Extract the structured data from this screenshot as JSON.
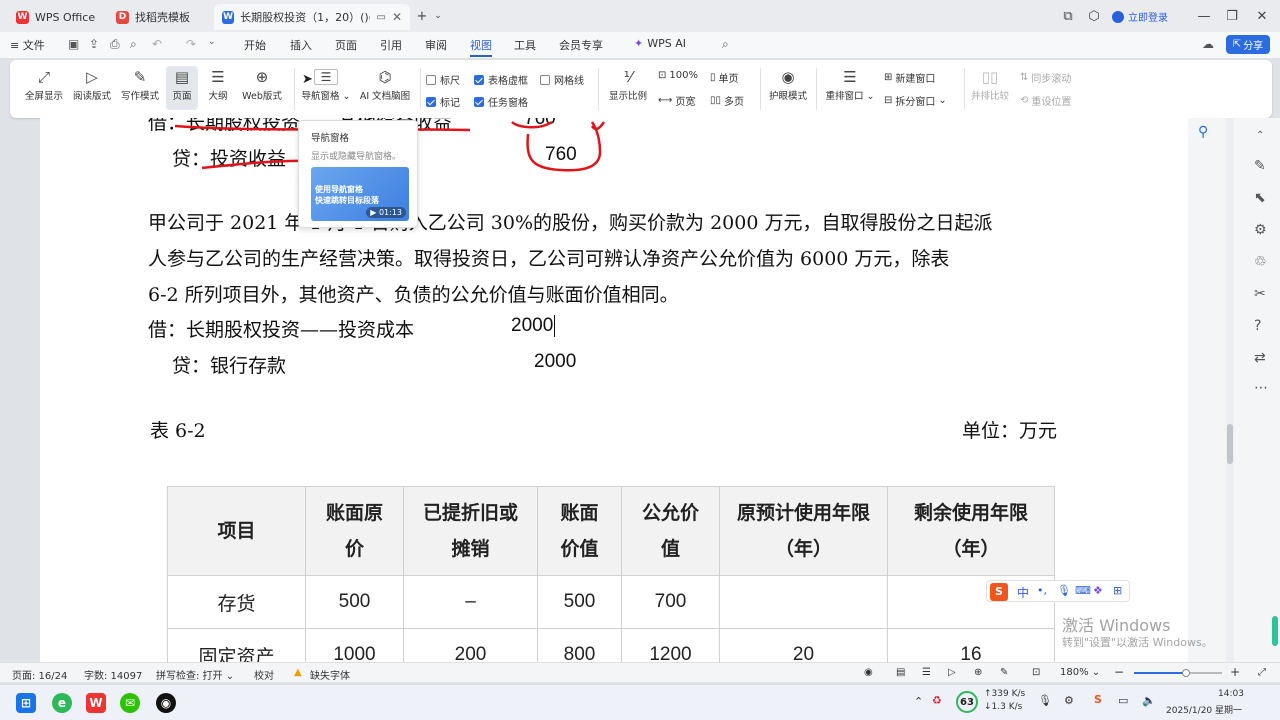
{
  "tabs": [
    {
      "label": "WPS Office",
      "icon": "wps-logo-icon",
      "color": "#e33"
    },
    {
      "label": "找稻壳模板",
      "icon": "docer-template-icon",
      "color": "#e5483c"
    },
    {
      "label": "长期股权投资（1，20）()(1).d",
      "icon": "word-doc-icon",
      "color": "#2b6de0"
    }
  ],
  "title_bar": {
    "login_label": "立即登录"
  },
  "menu": {
    "file_label": "文件",
    "items": [
      "开始",
      "插入",
      "页面",
      "引用",
      "审阅",
      "视图",
      "工具",
      "会员专享"
    ],
    "active": "视图",
    "wps_ai_label": "WPS AI",
    "share_label": "分享"
  },
  "ribbon": {
    "buttons": [
      "全屏显示",
      "阅读版式",
      "写作模式",
      "页面",
      "大纲",
      "Web版式",
      "导航窗格",
      "AI 文档脑图"
    ],
    "selected": "页面",
    "checks": [
      {
        "label": "标尺",
        "checked": false
      },
      {
        "label": "表格虚框",
        "checked": true
      },
      {
        "label": "网格线",
        "checked": false
      },
      {
        "label": "标记",
        "checked": true
      },
      {
        "label": "任务窗格",
        "checked": true
      }
    ],
    "zoom_buttons": [
      "显示比例",
      "100%",
      "单页",
      "页宽",
      "多页"
    ],
    "eye_label": "护眼模式",
    "window_buttons": [
      "重排窗口",
      "新建窗口",
      "拆分窗口",
      "并排比较",
      "同步滚动",
      "重设位置"
    ]
  },
  "tooltip": {
    "title": "导航窗格",
    "desc": "显示或隐藏导航窗格。",
    "video_line1": "使用导航窗格",
    "video_line2": "快速跳转目标段落",
    "duration": "01:13"
  },
  "document": {
    "line_top1": "借：长期股权投资——其他综合收益",
    "line_top1_amount": "760",
    "line_top2": "贷：投资收益",
    "line_top2_amount": "760",
    "para1": "甲公司于 2021 年 1 月 1 日购入乙公司 30%的股份，购买价款为 2000 万元，自取得股份之日起派",
    "para2": "人参与乙公司的生产经营决策。取得投资日，乙公司可辨认净资产公允价值为 6000 万元，除表",
    "para3": "6-2 所列项目外，其他资产、负债的公允价值与账面价值相同。",
    "debit": "借：长期股权投资——投资成本",
    "debit_amount": "2000",
    "credit": "贷：银行存款",
    "credit_amount": "2000",
    "table_caption": "表 6-2",
    "table_unit": "单位：万元",
    "table_headers": [
      "项目",
      "账面原价",
      "已提折旧或摊销",
      "账面价值",
      "公允价值",
      "原预计使用年限（年）",
      "剩余使用年限（年）"
    ],
    "table_rows": [
      [
        "存货",
        "500",
        "–",
        "500",
        "700",
        "",
        ""
      ],
      [
        "固定资产",
        "1000",
        "200",
        "800",
        "1200",
        "20",
        "16"
      ]
    ]
  },
  "status": {
    "page": "页面: 16/24",
    "words": "字数: 14097",
    "spell": "拼写检查: 打开",
    "proof": "校对",
    "missing_font": "缺失字体",
    "zoom": "180%"
  },
  "ime": {
    "label": "中"
  },
  "watermark": {
    "line1": "激活 Windows",
    "line2": "转到\"设置\"以激活 Windows。"
  },
  "taskbar": {
    "net_up": "339 K/s",
    "net_down": "1.3 K/s",
    "badge": "63",
    "time": "14:03",
    "date": "2025/1/20 星期一"
  },
  "colors": {
    "accent": "#2b5fd9",
    "red_ink": "#e0141a",
    "wps_red": "#e33"
  }
}
